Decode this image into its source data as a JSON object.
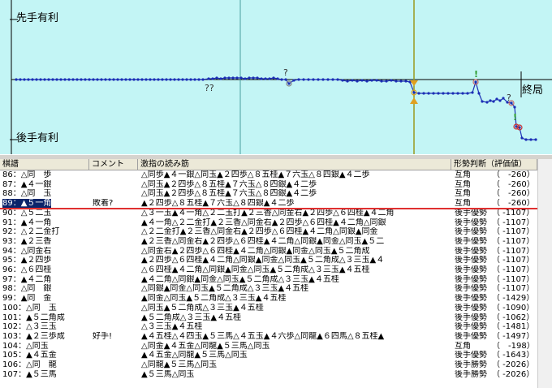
{
  "graph": {
    "top_label": "先手有利",
    "bottom_label": "後手有利",
    "end_label": "終局",
    "question_marks": [
      "??",
      "?",
      "?"
    ],
    "exclaim_marks": [
      "!",
      "!"
    ],
    "colors": {
      "background": "#c3f5f5",
      "line": "#1c2fb5",
      "cursor": "#9a9a20",
      "midline": "#4aa0a0"
    }
  },
  "table": {
    "columns": [
      "棋譜",
      "コメント",
      "激指の読み筋",
      "形勢判断（評価値）"
    ],
    "rows": [
      {
        "move": "86：△同　歩",
        "comment": "",
        "pv": "△同歩▲４一銀△同玉▲２四歩△８五桂▲７六玉△８四銀▲４二歩",
        "judge": "互角",
        "score": "（　-260）"
      },
      {
        "move": "87：▲４一銀",
        "comment": "",
        "pv": "△同玉▲２四歩△８五桂▲７六玉△８四銀▲４二歩",
        "judge": "互角",
        "score": "（　-260）"
      },
      {
        "move": "88：△同　玉",
        "comment": "",
        "pv": "△同玉▲２四歩△８五桂▲７六玉△８四銀▲４二歩",
        "judge": "互角",
        "score": "（　-260）"
      },
      {
        "move": "89：▲５一角",
        "comment": "敗着?",
        "pv": "▲２四歩△８五桂▲７六玉△８四銀▲４二歩",
        "judge": "互角",
        "score": "（　-260）"
      },
      {
        "move": "90：△５二玉",
        "comment": "",
        "pv": "△３一玉▲４一角△２二玉打▲２三香△同金右▲２四歩△６四桂▲４二角",
        "judge": "後手優勢",
        "score": "（ -1107）"
      },
      {
        "move": "91：▲４一角",
        "comment": "",
        "pv": "▲４一角△２二金打▲２三香△同金右▲２四歩△６四桂▲４二角△同銀",
        "judge": "後手優勢",
        "score": "（ -1107）"
      },
      {
        "move": "92：△２二金打",
        "comment": "",
        "pv": "△２二金打▲２三香△同金右▲２四歩△６四桂▲４二角△同銀▲同金",
        "judge": "後手優勢",
        "score": "（ -1107）"
      },
      {
        "move": "93：▲２三香",
        "comment": "",
        "pv": "▲２三香△同金右▲２四歩△６四桂▲４二角△同銀▲同金△同玉▲５二",
        "judge": "後手優勢",
        "score": "（ -1107）"
      },
      {
        "move": "94：△同金右",
        "comment": "",
        "pv": "△同金右▲２四歩△６四桂▲４二角△同銀▲同金△同玉▲５二角成",
        "judge": "後手優勢",
        "score": "（ -1107）"
      },
      {
        "move": "95：▲２四歩",
        "comment": "",
        "pv": "▲２四歩△６四桂▲４二角△同銀▲同金△同玉▲５二角成△３三玉▲４",
        "judge": "後手優勢",
        "score": "（ -1107）"
      },
      {
        "move": "96：△６四桂",
        "comment": "",
        "pv": "△６四桂▲４二角△同銀▲同金△同玉▲５二角成△３三玉▲４五桂",
        "judge": "後手優勢",
        "score": "（ -1107）"
      },
      {
        "move": "97：▲４二角",
        "comment": "",
        "pv": "▲４二角△同銀▲同金△同玉▲５二角成△３三玉▲４五桂",
        "judge": "後手優勢",
        "score": "（ -1107）"
      },
      {
        "move": "98：△同　銀",
        "comment": "",
        "pv": "△同銀▲同金△同玉▲５二角成△３三玉▲４五桂",
        "judge": "後手優勢",
        "score": "（ -1107）"
      },
      {
        "move": "99：▲同　金",
        "comment": "",
        "pv": "▲同金△同玉▲５二角成△３三玉▲４五桂",
        "judge": "後手優勢",
        "score": "（ -1429）"
      },
      {
        "move": "100：△同　玉",
        "comment": "",
        "pv": "△同玉▲５二角成△３三玉▲４五桂",
        "judge": "後手優勢",
        "score": "（ -1090）"
      },
      {
        "move": "101：▲５二角成",
        "comment": "",
        "pv": "▲５二角成△３三玉▲４五桂",
        "judge": "後手優勢",
        "score": "（ -1062）"
      },
      {
        "move": "102：△３三玉",
        "comment": "",
        "pv": "△３三玉▲４五桂",
        "judge": "後手優勢",
        "score": "（ -1481）"
      },
      {
        "move": "103：▲２三歩成",
        "comment": "好手!",
        "pv": "▲４五桂△４四玉▲５三馬△４五玉▲４六歩△同龍▲６四馬△８五桂▲",
        "judge": "後手優勢",
        "score": "（ -1497）"
      },
      {
        "move": "104：△同玉",
        "comment": "",
        "pv": "△同金▲４五金△同龍▲５三馬△同玉",
        "judge": "互角",
        "score": "（　-198）"
      },
      {
        "move": "105：▲４五金",
        "comment": "",
        "pv": "▲４五金△同龍▲５三馬△同玉",
        "judge": "後手優勢",
        "score": "（ -1643）"
      },
      {
        "move": "106：△同　龍",
        "comment": "",
        "pv": "△同龍▲５三馬△同玉",
        "judge": "後手勝勢",
        "score": "（ -2026）"
      },
      {
        "move": "107：▲５三馬",
        "comment": "",
        "pv": "▲５三馬△同玉",
        "judge": "後手勝勢",
        "score": "（ -2026）"
      }
    ]
  }
}
